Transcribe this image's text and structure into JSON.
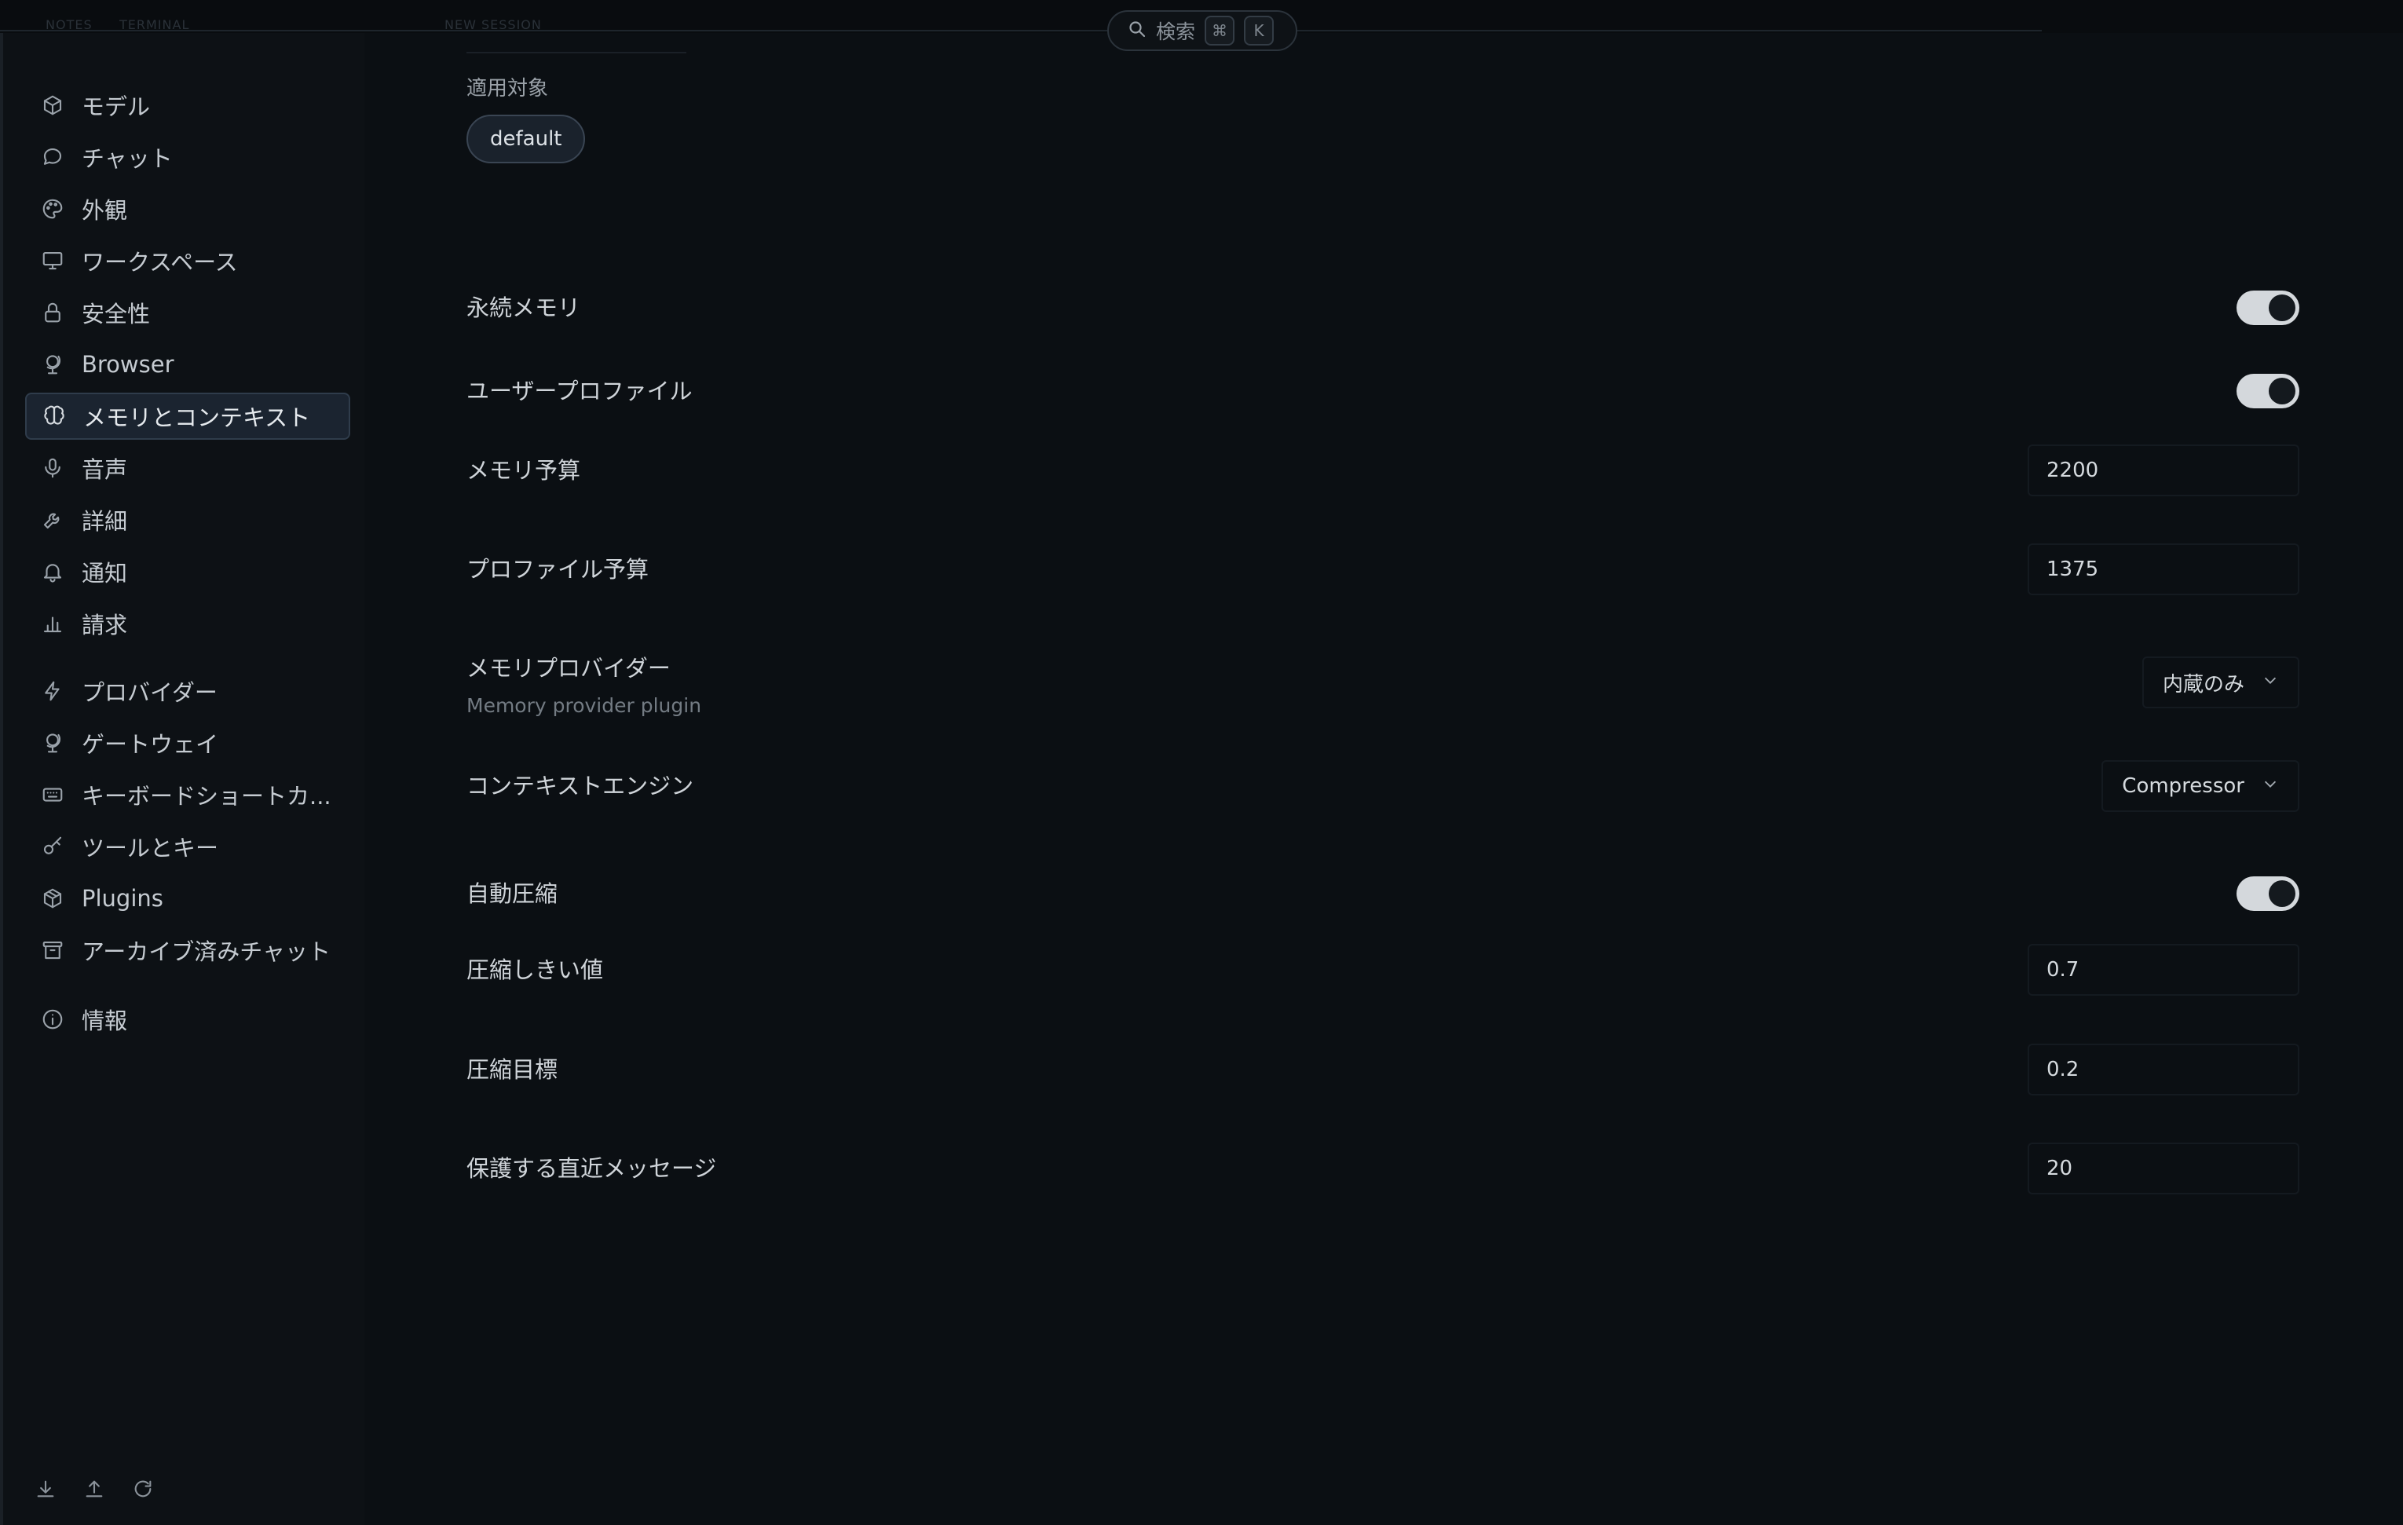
{
  "search": {
    "label": "検索",
    "key1": "⌘",
    "key2": "K"
  },
  "topbar": {
    "ghost_tabs": [
      "NOTES",
      "TERMINAL",
      "NEW SESSION"
    ]
  },
  "sidebar": {
    "items": [
      {
        "label": "モデル",
        "icon": "cube-icon"
      },
      {
        "label": "チャット",
        "icon": "chat-bubble-icon"
      },
      {
        "label": "外観",
        "icon": "palette-icon"
      },
      {
        "label": "ワークスペース",
        "icon": "monitor-icon"
      },
      {
        "label": "安全性",
        "icon": "lock-icon"
      },
      {
        "label": "Browser",
        "icon": "globe-stand-icon"
      },
      {
        "label": "メモリとコンテキスト",
        "icon": "brain-icon",
        "active": true
      },
      {
        "label": "音声",
        "icon": "microphone-icon"
      },
      {
        "label": "詳細",
        "icon": "wrench-icon"
      },
      {
        "label": "通知",
        "icon": "bell-icon"
      },
      {
        "label": "請求",
        "icon": "bar-chart-icon"
      },
      {
        "label": "プロバイダー",
        "icon": "lightning-icon"
      },
      {
        "label": "ゲートウェイ",
        "icon": "globe-stand-icon"
      },
      {
        "label": "キーボードショートカ...",
        "icon": "keyboard-icon"
      },
      {
        "label": "ツールとキー",
        "icon": "key-icon"
      },
      {
        "label": "Plugins",
        "icon": "package-icon"
      },
      {
        "label": "アーカイブ済みチャット",
        "icon": "archive-icon"
      },
      {
        "label": "情報",
        "icon": "info-icon"
      }
    ],
    "bottom_icons": [
      "download-icon",
      "upload-icon",
      "refresh-icon"
    ]
  },
  "main": {
    "applies_label": "適用対象",
    "applies_chip": "default",
    "settings": {
      "persistent_memory": {
        "label": "永続メモリ",
        "enabled": true
      },
      "user_profile": {
        "label": "ユーザープロファイル",
        "enabled": true
      },
      "memory_budget": {
        "label": "メモリ予算",
        "value": "2200"
      },
      "profile_budget": {
        "label": "プロファイル予算",
        "value": "1375"
      },
      "memory_provider": {
        "label": "メモリプロバイダー",
        "sub": "Memory provider plugin",
        "value": "内蔵のみ"
      },
      "context_engine": {
        "label": "コンテキストエンジン",
        "value": "Compressor"
      },
      "auto_compress": {
        "label": "自動圧縮",
        "enabled": true
      },
      "compress_threshold": {
        "label": "圧縮しきい値",
        "value": "0.7"
      },
      "compress_target": {
        "label": "圧縮目標",
        "value": "0.2"
      },
      "protected_recent": {
        "label": "保護する直近メッセージ",
        "value": "20"
      }
    }
  }
}
